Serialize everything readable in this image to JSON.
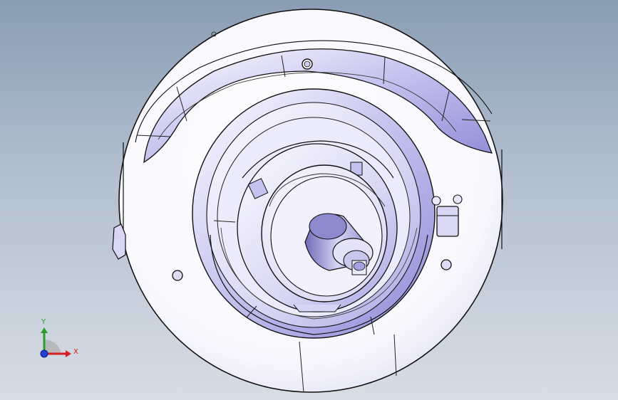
{
  "viewport": {
    "background_top": "#8a9db4",
    "background_bottom": "#d7dde5",
    "part_fill": "#ffffff",
    "part_shade": "#b9b6ea",
    "edge_color": "#111111"
  },
  "triad": {
    "x_label": "X",
    "y_label": "Y",
    "x_color": "#d42020",
    "y_color": "#2a9d2a",
    "z_color": "#1f3fd6"
  }
}
